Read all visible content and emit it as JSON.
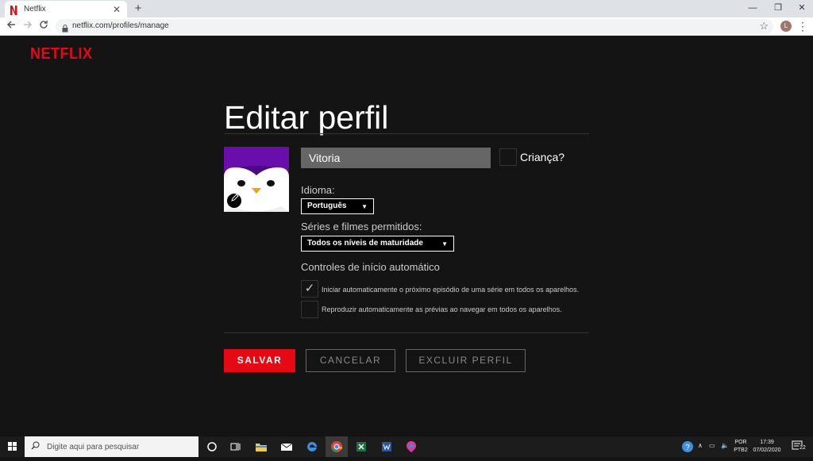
{
  "browser": {
    "tab_title": "Netflix",
    "tab_close": "✕",
    "new_tab": "+",
    "url": "netflix.com/profiles/manage",
    "profile_initial": "L",
    "minimize": "—",
    "restore": "❐",
    "close": "✕"
  },
  "page": {
    "logo": "NETFLIX",
    "heading": "Editar perfil",
    "profile_name": "Vitoria",
    "kid_label": "Criança?",
    "language_label": "Idioma:",
    "language_value": "Português",
    "maturity_label": "Séries e filmes permitidos:",
    "maturity_value": "Todos os níveis de maturidade",
    "autoplay_heading": "Controles de início automático",
    "autoplay_next": {
      "label": "Iniciar automaticamente o próximo episódio de uma série em todos os aparelhos.",
      "checked": true
    },
    "autoplay_previews": {
      "label": "Reproduzir automaticamente as prévias ao navegar em todos os aparelhos.",
      "checked": false
    },
    "save": "SALVAR",
    "cancel": "CANCELAR",
    "delete": "EXCLUIR PERFIL"
  },
  "taskbar": {
    "search_placeholder": "Digite aqui para pesquisar",
    "lang_top": "POR",
    "lang_bottom": "PTB2",
    "time": "17:39",
    "date": "07/02/2020",
    "notif_count": "22"
  },
  "colors": {
    "brand": "#e50914",
    "bg": "#141414",
    "avatar": "#6a0dad"
  }
}
